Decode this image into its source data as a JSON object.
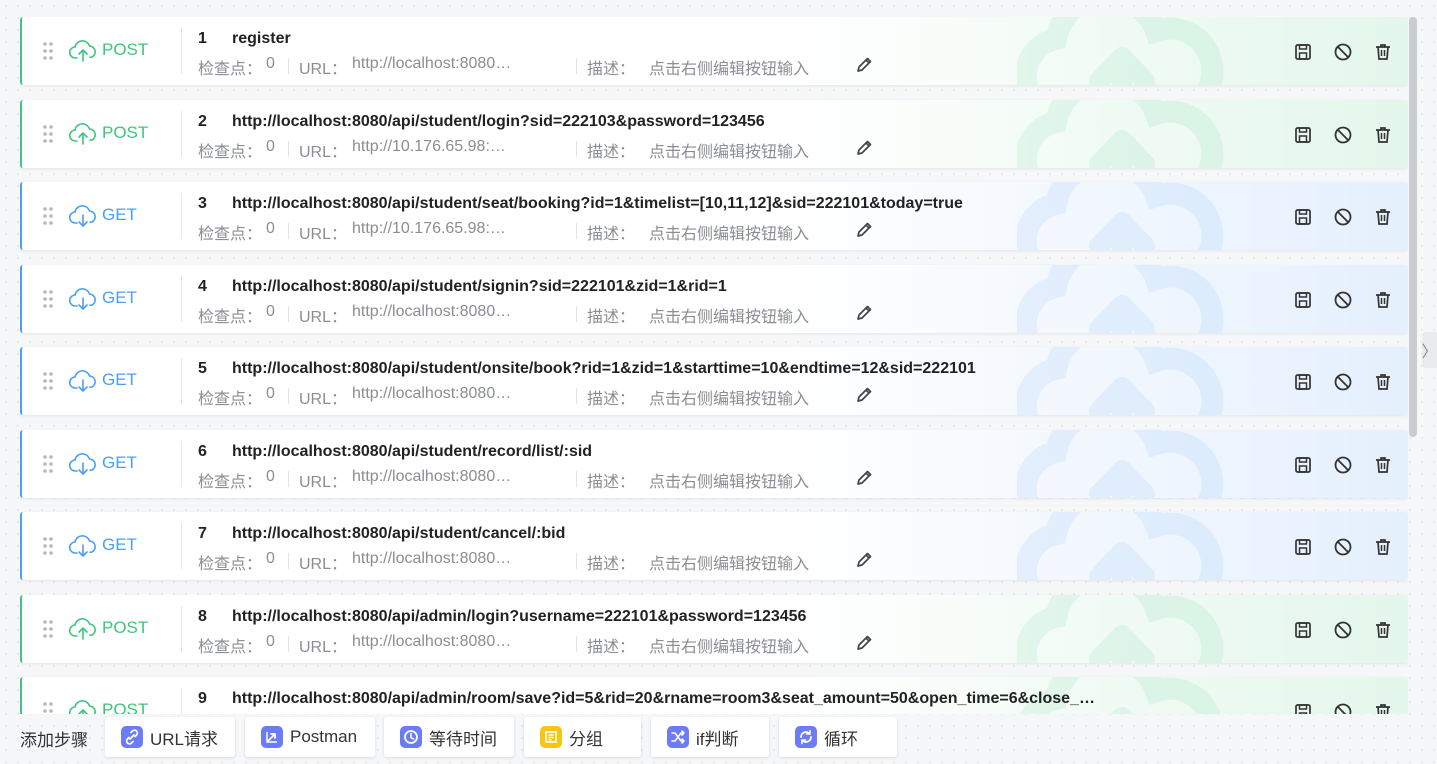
{
  "labels": {
    "checkpoint": "检查点：",
    "url": "URL：",
    "desc": "描述：",
    "desc_placeholder": "点击右侧编辑按钮输入"
  },
  "icons": {
    "drag": "drag-handle-icon",
    "upload": "cloud-upload-icon",
    "download": "cloud-download-icon",
    "edit": "pencil-icon",
    "save": "floppy-disk-icon",
    "disable": "ban-icon",
    "delete": "trash-icon"
  },
  "colors": {
    "post": "#3fc57c",
    "get": "#4b9ff5"
  },
  "steps": [
    {
      "num": "1",
      "method": "POST",
      "title": "register",
      "checkpoints": "0",
      "url": "http://localhost:8080…"
    },
    {
      "num": "2",
      "method": "POST",
      "title": "http://localhost:8080/api/student/login?sid=222103&password=123456",
      "checkpoints": "0",
      "url": "http://10.176.65.98:…"
    },
    {
      "num": "3",
      "method": "GET",
      "title": "http://localhost:8080/api/student/seat/booking?id=1&timelist=[10,11,12]&sid=222101&today=true",
      "checkpoints": "0",
      "url": "http://10.176.65.98:…"
    },
    {
      "num": "4",
      "method": "GET",
      "title": "http://localhost:8080/api/student/signin?sid=222101&zid=1&rid=1",
      "checkpoints": "0",
      "url": "http://localhost:8080…"
    },
    {
      "num": "5",
      "method": "GET",
      "title": "http://localhost:8080/api/student/onsite/book?rid=1&zid=1&starttime=10&endtime=12&sid=222101",
      "checkpoints": "0",
      "url": "http://localhost:8080…"
    },
    {
      "num": "6",
      "method": "GET",
      "title": "http://localhost:8080/api/student/record/list/:sid",
      "checkpoints": "0",
      "url": "http://localhost:8080…"
    },
    {
      "num": "7",
      "method": "GET",
      "title": "http://localhost:8080/api/student/cancel/:bid",
      "checkpoints": "0",
      "url": "http://localhost:8080…"
    },
    {
      "num": "8",
      "method": "POST",
      "title": "http://localhost:8080/api/admin/login?username=222101&password=123456",
      "checkpoints": "0",
      "url": "http://localhost:8080…"
    },
    {
      "num": "9",
      "method": "POST",
      "title": "http://localhost:8080/api/admin/room/save?id=5&rid=20&rname=room3&seat_amount=50&open_time=6&close_…",
      "checkpoints": "0",
      "url": "http://localhost:8080…"
    }
  ],
  "footer": {
    "label": "添加步骤",
    "buttons": [
      {
        "label": "URL请求",
        "icon": "link-icon",
        "color": "#6b7cf6"
      },
      {
        "label": "Postman",
        "icon": "postman-icon",
        "color": "#6b7cf6"
      },
      {
        "label": "等待时间",
        "icon": "clock-icon",
        "color": "#6b7cf6"
      },
      {
        "label": "分组",
        "icon": "group-icon",
        "color": "#f5c518"
      },
      {
        "label": "if判断",
        "icon": "shuffle-icon",
        "color": "#6b7cf6"
      },
      {
        "label": "循环",
        "icon": "loop-icon",
        "color": "#6b7cf6"
      }
    ]
  },
  "side_toggle": "〉"
}
